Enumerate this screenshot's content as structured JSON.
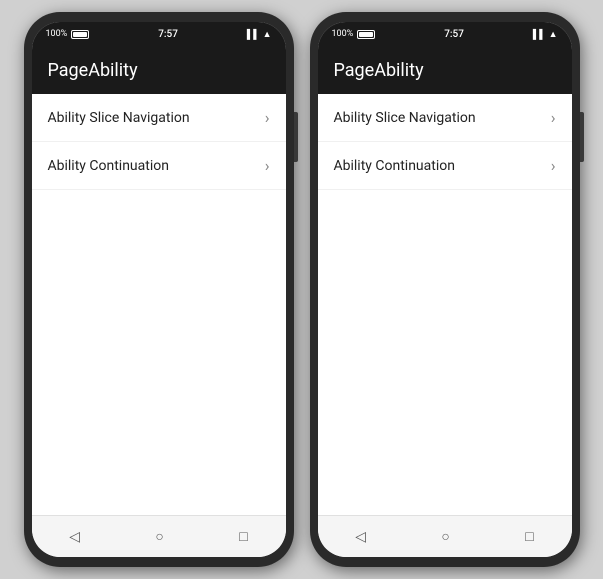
{
  "phones": [
    {
      "id": "phone-left",
      "status_bar": {
        "left_icons": "100%⊡",
        "time": "7:57",
        "signal": "▌▌▌"
      },
      "app_bar": {
        "title": "PageAbility"
      },
      "menu_items": [
        {
          "label": "Ability Slice Navigation"
        },
        {
          "label": "Ability Continuation"
        }
      ],
      "nav_bar": {
        "back": "◁",
        "home": "○",
        "recent": "□"
      }
    },
    {
      "id": "phone-right",
      "status_bar": {
        "time": "7:57"
      },
      "app_bar": {
        "title": "PageAbility"
      },
      "menu_items": [
        {
          "label": "Ability Slice Navigation"
        },
        {
          "label": "Ability Continuation"
        }
      ],
      "nav_bar": {
        "back": "◁",
        "home": "○",
        "recent": "□"
      }
    }
  ]
}
